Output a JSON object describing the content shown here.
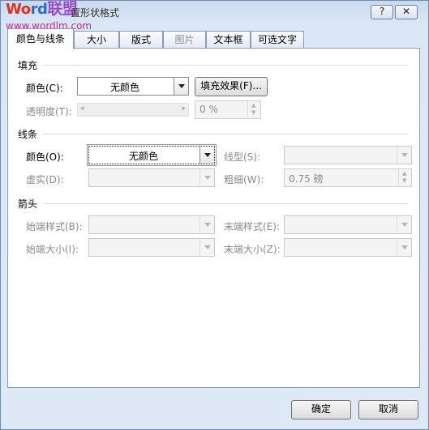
{
  "watermark": {
    "logo_a": "Wo",
    "logo_b": "rd",
    "logo_c": "联盟",
    "url": "www.wordlm.com"
  },
  "window": {
    "title": "置形状格式"
  },
  "titlebar": {
    "help": "?",
    "close": "✕"
  },
  "tabs": [
    {
      "label": "颜色与线条",
      "active": true,
      "enabled": true
    },
    {
      "label": "大小",
      "active": false,
      "enabled": true
    },
    {
      "label": "版式",
      "active": false,
      "enabled": true
    },
    {
      "label": "图片",
      "active": false,
      "enabled": false
    },
    {
      "label": "文本框",
      "active": false,
      "enabled": true
    },
    {
      "label": "可选文字",
      "active": false,
      "enabled": true
    }
  ],
  "fill": {
    "section": "填充",
    "color_label": "颜色(C):",
    "color_value": "无颜色",
    "effects_button": "填充效果(F)...",
    "transparency_label": "透明度(T):",
    "transparency_value": "0 %"
  },
  "line": {
    "section": "线条",
    "color_label": "颜色(O):",
    "color_value": "无颜色",
    "style_label": "线型(S):",
    "dash_label": "虚实(D):",
    "weight_label": "粗细(W):",
    "weight_value": "0.75 磅"
  },
  "arrows": {
    "section": "箭头",
    "begin_style_label": "始端样式(B):",
    "end_style_label": "末端样式(E):",
    "begin_size_label": "始端大小(I):",
    "end_size_label": "末端大小(Z):"
  },
  "footer": {
    "ok": "确定",
    "cancel": "取消"
  }
}
